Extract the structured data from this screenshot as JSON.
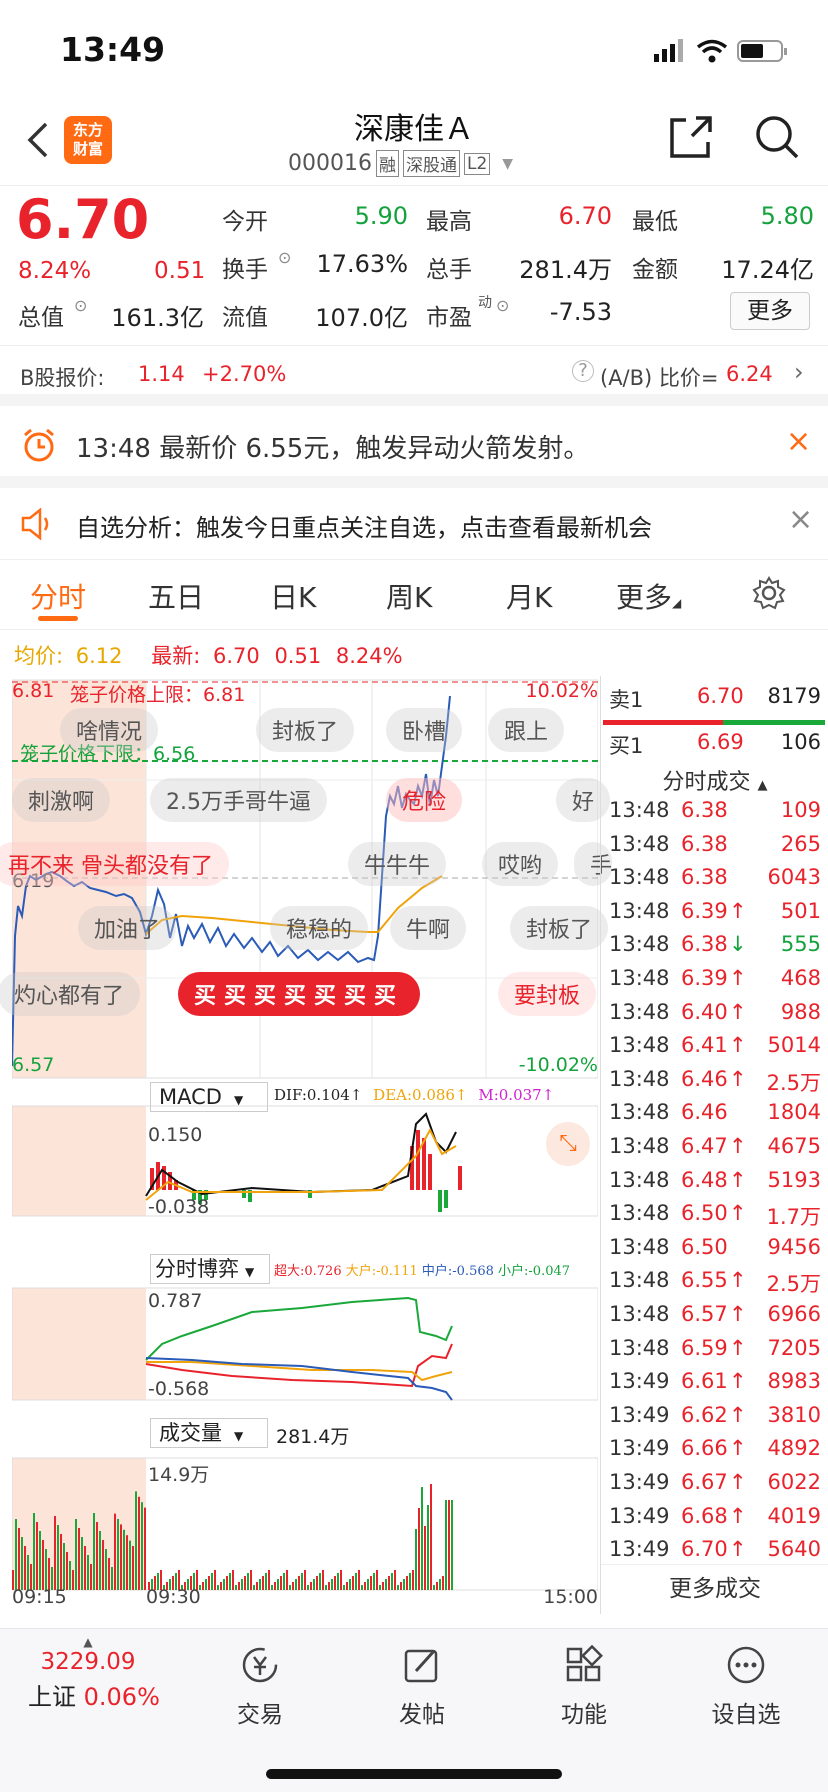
{
  "status": {
    "time": "13:49"
  },
  "header": {
    "title": "深康佳Ａ",
    "code": "000016",
    "tags": [
      "融",
      "深股通",
      "L2"
    ],
    "logo_text": [
      "东方",
      "财富"
    ]
  },
  "quote": {
    "price": "6.70",
    "pct": "8.24%",
    "change": "0.51",
    "fields": [
      {
        "label": "今开",
        "value": "5.90",
        "color": "green"
      },
      {
        "label": "最高",
        "value": "6.70",
        "color": "red"
      },
      {
        "label": "最低",
        "value": "5.80",
        "color": "green"
      },
      {
        "label": "换手",
        "value": "17.63%",
        "color": "dark"
      },
      {
        "label": "总手",
        "value": "281.4万",
        "color": "dark"
      },
      {
        "label": "金额",
        "value": "17.24亿",
        "color": "dark"
      },
      {
        "label": "总值",
        "value": "161.3亿",
        "color": "dark"
      },
      {
        "label": "流值",
        "value": "107.0亿",
        "color": "dark"
      },
      {
        "label": "市盈",
        "value": "-7.53",
        "color": "dark"
      }
    ],
    "pe_sup": "动",
    "more_btn": "更多"
  },
  "bshare": {
    "label": "B股报价:",
    "price": "1.14",
    "pct": "+2.70%",
    "ratio_label": "(A/B) 比价=",
    "ratio": "6.24"
  },
  "alert": {
    "text": "13:48 最新价 6.55元，触发异动火箭发射。"
  },
  "analysis": {
    "text": "自选分析：触发今日重点关注自选，点击查看最新机会"
  },
  "tabs": [
    "分时",
    "五日",
    "日K",
    "周K",
    "月K",
    "更多"
  ],
  "avg": {
    "avg_label": "均价:",
    "avg": "6.12",
    "latest_label": "最新:",
    "latest": "6.70",
    "chg": "0.51",
    "pct": "8.24%"
  },
  "chart": {
    "y_high": "6.81",
    "y_low": "6.57",
    "y_mid": "6.19",
    "pct_high": "10.02%",
    "pct_low": "-10.02%",
    "cage_up": "笼子价格上限：6.81",
    "cage_down": "笼子价格下限：6.56",
    "macd": {
      "label": "MACD",
      "dif": "DIF:0.104",
      "dea": "DEA:0.086",
      "m": "M:0.037",
      "top": "0.150",
      "bottom": "-0.038"
    },
    "bo": {
      "label": "分时博弈",
      "chao": "超大:0.726",
      "da": "大户:-0.111",
      "zhong": "中户:-0.568",
      "xiao": "小户:-0.047",
      "top": "0.787",
      "bottom": "-0.568"
    },
    "vol": {
      "label": "成交量",
      "total": "281.4万",
      "top": "14.9万"
    },
    "times": [
      "09:15",
      "09:30",
      "15:00"
    ]
  },
  "danmu": [
    "啥情况",
    "封板了",
    "卧槽",
    "跟上",
    "刺激啊",
    "2.5万手哥牛逼",
    "危险",
    "好",
    "再不来 骨头都没有了",
    "牛牛牛",
    "哎哟",
    "手",
    "加油了",
    "稳稳的",
    "牛啊",
    "封板了",
    "灼心都有了",
    "买买买买买买买",
    "要封板"
  ],
  "orderbook": {
    "sell_label": "卖1",
    "sell_price": "6.70",
    "sell_vol": "8179",
    "buy_label": "买1",
    "buy_price": "6.69",
    "buy_vol": "106"
  },
  "trades_title": "分时成交",
  "trades": [
    [
      "13:48",
      "6.38",
      "",
      "109",
      "red"
    ],
    [
      "13:48",
      "6.38",
      "",
      "265",
      "red"
    ],
    [
      "13:48",
      "6.38",
      "",
      "6043",
      "red"
    ],
    [
      "13:48",
      "6.39",
      "↑",
      "501",
      "red"
    ],
    [
      "13:48",
      "6.38",
      "↓",
      "555",
      "green"
    ],
    [
      "13:48",
      "6.39",
      "↑",
      "468",
      "red"
    ],
    [
      "13:48",
      "6.40",
      "↑",
      "988",
      "red"
    ],
    [
      "13:48",
      "6.41",
      "↑",
      "5014",
      "red"
    ],
    [
      "13:48",
      "6.46",
      "↑",
      "2.5万",
      "red"
    ],
    [
      "13:48",
      "6.46",
      "",
      "1804",
      "red"
    ],
    [
      "13:48",
      "6.47",
      "↑",
      "4675",
      "red"
    ],
    [
      "13:48",
      "6.48",
      "↑",
      "5193",
      "red"
    ],
    [
      "13:48",
      "6.50",
      "↑",
      "1.7万",
      "red"
    ],
    [
      "13:48",
      "6.50",
      "",
      "9456",
      "red"
    ],
    [
      "13:48",
      "6.55",
      "↑",
      "2.5万",
      "red"
    ],
    [
      "13:48",
      "6.57",
      "↑",
      "6966",
      "red"
    ],
    [
      "13:48",
      "6.59",
      "↑",
      "7205",
      "red"
    ],
    [
      "13:49",
      "6.61",
      "↑",
      "8983",
      "red"
    ],
    [
      "13:49",
      "6.62",
      "↑",
      "3810",
      "red"
    ],
    [
      "13:49",
      "6.66",
      "↑",
      "4892",
      "red"
    ],
    [
      "13:49",
      "6.67",
      "↑",
      "6022",
      "red"
    ],
    [
      "13:49",
      "6.68",
      "↑",
      "4019",
      "red"
    ],
    [
      "13:49",
      "6.70",
      "↑",
      "5640",
      "red"
    ]
  ],
  "more_trades": "更多成交",
  "bottom": {
    "index_value": "3229.09",
    "index_name": "上证",
    "index_pct": "0.06%",
    "items": [
      {
        "label": "交易",
        "icon": "yen-icon"
      },
      {
        "label": "发帖",
        "icon": "edit-icon"
      },
      {
        "label": "功能",
        "icon": "grid-icon"
      },
      {
        "label": "设自选",
        "icon": "dots-icon"
      }
    ]
  }
}
